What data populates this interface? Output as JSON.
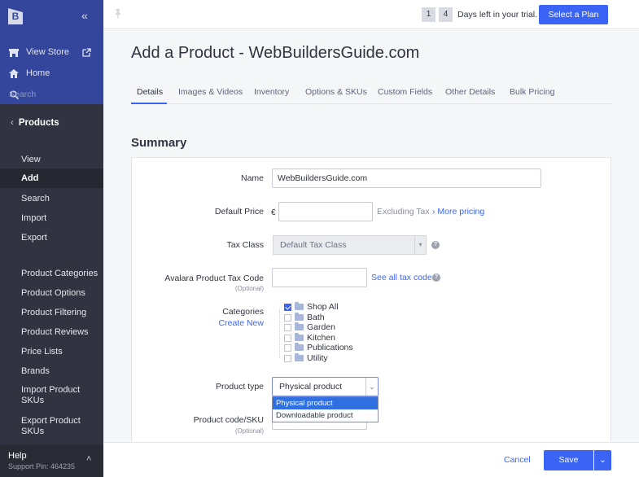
{
  "sidebar": {
    "logo": "B",
    "collapse_glyph": "«",
    "view_store": "View Store",
    "home": "Home",
    "search_placeholder": "Search",
    "section_title": "Products",
    "items": [
      {
        "label": "View"
      },
      {
        "label": "Add"
      },
      {
        "label": "Search"
      },
      {
        "label": "Import"
      },
      {
        "label": "Export"
      },
      {
        "label": "Product Categories"
      },
      {
        "label": "Product Options"
      },
      {
        "label": "Product Filtering"
      },
      {
        "label": "Product Reviews"
      },
      {
        "label": "Price Lists"
      },
      {
        "label": "Brands"
      },
      {
        "label": "Import Product SKUs"
      },
      {
        "label": "Export Product SKUs"
      }
    ],
    "active_item": "Add",
    "help": "Help",
    "support_pin": "Support Pin: 464235"
  },
  "topbar": {
    "days_digits": [
      "1",
      "4"
    ],
    "days_text": "Days left in your trial.",
    "select_plan": "Select a Plan"
  },
  "page": {
    "title": "Add a Product - WebBuildersGuide.com",
    "tabs": [
      "Details",
      "Images & Videos",
      "Inventory",
      "Options & SKUs",
      "Custom Fields",
      "Other Details",
      "Bulk Pricing"
    ],
    "active_tab": "Details",
    "section_title": "Summary"
  },
  "form": {
    "name_label": "Name",
    "name_value": "WebBuildersGuide.com",
    "price_label": "Default Price",
    "currency": "€",
    "price_value": "",
    "excluding_tax": "Excluding Tax",
    "more_pricing": "› More pricing",
    "tax_class_label": "Tax Class",
    "tax_class_value": "Default Tax Class",
    "avalara_label": "Avalara Product Tax Code",
    "avalara_sub": "(Optional)",
    "avalara_value": "",
    "see_tax_codes": "See all tax codes",
    "categories_label": "Categories",
    "create_new": "Create New",
    "categories": [
      {
        "name": "Shop All",
        "checked": true
      },
      {
        "name": "Bath",
        "checked": false
      },
      {
        "name": "Garden",
        "checked": false
      },
      {
        "name": "Kitchen",
        "checked": false
      },
      {
        "name": "Publications",
        "checked": false
      },
      {
        "name": "Utility",
        "checked": false
      }
    ],
    "product_type_label": "Product type",
    "product_type_value": "Physical product",
    "product_type_options": [
      "Physical product",
      "Downloadable product"
    ],
    "sku_label": "Product code/SKU",
    "sku_sub": "(Optional)"
  },
  "footer": {
    "cancel": "Cancel",
    "save": "Save"
  },
  "colors": {
    "accent": "#3c64f4",
    "sidebar_top": "#34469c",
    "sidebar": "#313440"
  }
}
